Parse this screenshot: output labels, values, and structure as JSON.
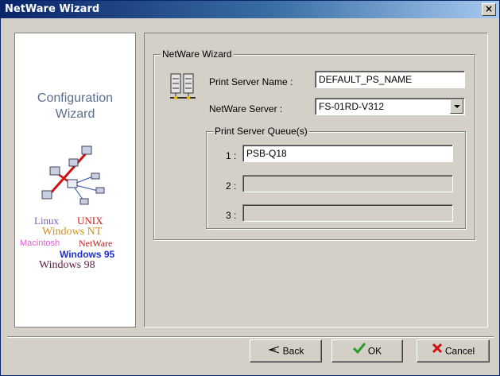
{
  "window": {
    "title": "NetWare Wizard",
    "close_label": "×"
  },
  "sidebar": {
    "title_line1": "Configuration",
    "title_line2": "Wizard",
    "os": {
      "linux": "Linux",
      "unix": "UNIX",
      "winnt": "Windows NT",
      "mac": "Macintosh",
      "netware": "NetWare",
      "win95": "Windows 95",
      "win98": "Windows 98"
    }
  },
  "form": {
    "group_label": "NetWare Wizard",
    "print_server_name_label": "Print Server Name :",
    "print_server_name_value": "DEFAULT_PS_NAME",
    "netware_server_label": "NetWare Server :",
    "netware_server_value": "FS-01RD-V312",
    "queues": {
      "group_label": "Print Server Queue(s)",
      "items": [
        {
          "label": "1 :",
          "value": "PSB-Q18"
        },
        {
          "label": "2 :",
          "value": ""
        },
        {
          "label": "3 :",
          "value": ""
        }
      ]
    }
  },
  "buttons": {
    "back": "Back",
    "ok": "OK",
    "cancel": "Cancel"
  },
  "colors": {
    "title_gradient_start": "#0a246a",
    "face": "#d4d0c8",
    "ok_check": "#2a9a2a",
    "cancel_x": "#d01010"
  }
}
